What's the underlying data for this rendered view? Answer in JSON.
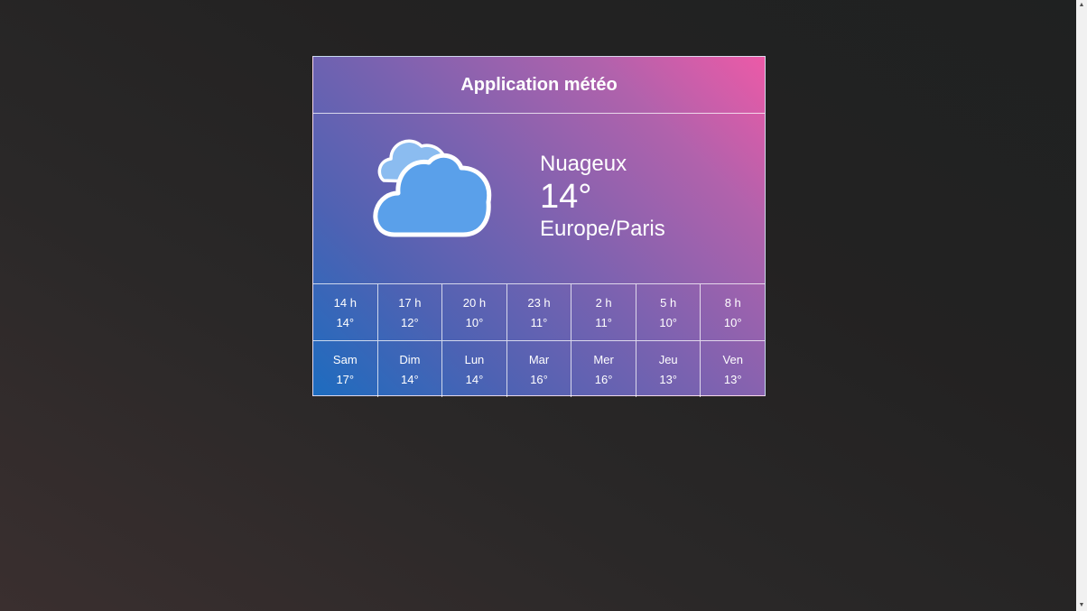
{
  "app": {
    "title": "Application météo"
  },
  "current": {
    "icon": "cloudy-icon",
    "condition": "Nuageux",
    "temperature": "14°",
    "timezone": "Europe/Paris"
  },
  "hourly": [
    {
      "time": "14 h",
      "temp": "14°"
    },
    {
      "time": "17 h",
      "temp": "12°"
    },
    {
      "time": "20 h",
      "temp": "10°"
    },
    {
      "time": "23 h",
      "temp": "11°"
    },
    {
      "time": "2 h",
      "temp": "11°"
    },
    {
      "time": "5 h",
      "temp": "10°"
    },
    {
      "time": "8 h",
      "temp": "10°"
    }
  ],
  "daily": [
    {
      "day": "Sam",
      "temp": "17°"
    },
    {
      "day": "Dim",
      "temp": "14°"
    },
    {
      "day": "Lun",
      "temp": "14°"
    },
    {
      "day": "Mar",
      "temp": "16°"
    },
    {
      "day": "Mer",
      "temp": "16°"
    },
    {
      "day": "Jeu",
      "temp": "13°"
    },
    {
      "day": "Ven",
      "temp": "13°"
    }
  ],
  "colors": {
    "gradient_start": "#1d6cbf",
    "gradient_end": "#ec5aa7",
    "cloud_fill": "#5aa0ea",
    "cloud_back_fill": "#8bbcf0"
  }
}
